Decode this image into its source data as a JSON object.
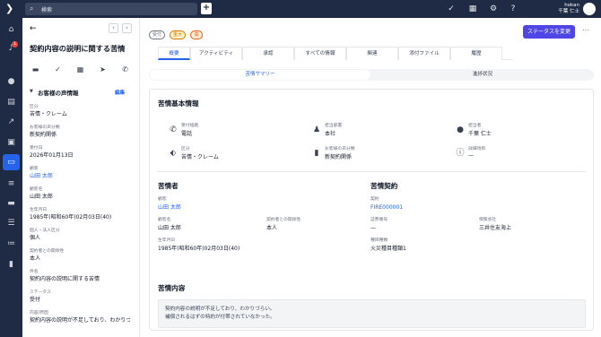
{
  "topbar": {
    "search_placeholder": "検索",
    "user_name": "hokan",
    "user_fullname": "千葉 仁士"
  },
  "left_panel": {
    "title": "契約内容の説明に関する苦情",
    "section_title": "お客様の声情報",
    "edit_label": "編集",
    "fields": [
      {
        "label": "区分",
        "value": "苦情・クレーム",
        "link": false
      },
      {
        "label": "お客様の声分類",
        "value": "新契約関係",
        "link": false
      },
      {
        "label": "受付日",
        "value": "2026年01月13日",
        "link": false
      },
      {
        "label": "顧客",
        "value": "山田 太郎",
        "link": true
      },
      {
        "label": "顧客名",
        "value": "山田 太郎",
        "link": false
      },
      {
        "label": "生年月日",
        "value": "1985年(昭和60年)02月03日(40)",
        "link": false
      },
      {
        "label": "個人・法人区分",
        "value": "個人",
        "link": false
      },
      {
        "label": "契約者との関係性",
        "value": "本人",
        "link": false
      },
      {
        "label": "件名",
        "value": "契約内容の説明に関する苦情",
        "link": false
      },
      {
        "label": "ステータス",
        "value": "受付",
        "link": false
      },
      {
        "label": "内容/原因",
        "value": "契約内容の説明が不足しており、わかりづら",
        "link": false
      }
    ]
  },
  "main": {
    "tags": [
      {
        "label": "受付",
        "color": "#6b7280",
        "bg": "#ffffff"
      },
      {
        "label": "重大",
        "color": "#d97706",
        "bg": "#fef3c7"
      },
      {
        "label": "高",
        "color": "#ea580c",
        "bg": "#ffedd5"
      }
    ],
    "status_button": "ステータスを変更",
    "tabs": [
      "概要",
      "アクティビティ",
      "承認",
      "すべての情報",
      "関連",
      "添付ファイル",
      "履歴"
    ],
    "subtabs": [
      "苦情サマリー",
      "進捗状況"
    ],
    "basic": {
      "heading": "苦情基本情報",
      "items": [
        {
          "label": "受付経路",
          "value": "電話",
          "icon": "phone-icon"
        },
        {
          "label": "担当部署",
          "value": "本社",
          "icon": "org-icon"
        },
        {
          "label": "担当者",
          "value": "千葉 仁士",
          "icon": "person-icon"
        },
        {
          "label": "区分",
          "value": "苦情・クレーム",
          "icon": "tag-icon"
        },
        {
          "label": "お客様の声分類",
          "value": "新契約関係",
          "icon": "bookmark-icon"
        },
        {
          "label": "詳細項目",
          "value": "—",
          "icon": "info-icon"
        }
      ]
    },
    "complainant": {
      "heading": "苦情者",
      "customer_label": "顧客",
      "customer_value": "山田 太郎",
      "name_label": "顧客名",
      "name_value": "山田 太郎",
      "relation_label": "契約者との関係性",
      "relation_value": "本人",
      "birth_label": "生年月日",
      "birth_value": "1985年(昭和60年)02月03日(40)"
    },
    "contract": {
      "heading": "苦情契約",
      "contract_label": "契約",
      "contract_value": "FIRE000001",
      "policy_label": "証券番号",
      "policy_value": "—",
      "insurer_label": "保険会社",
      "insurer_value": "三井住友海上",
      "type_label": "種目種類",
      "type_value": "火災種目種類1"
    },
    "content": {
      "heading": "苦情内容",
      "line1": "契約内容の説明が不足しており、わかりづらい。",
      "line2": "補償されるはずの特約が付帯されていなかった。"
    }
  }
}
